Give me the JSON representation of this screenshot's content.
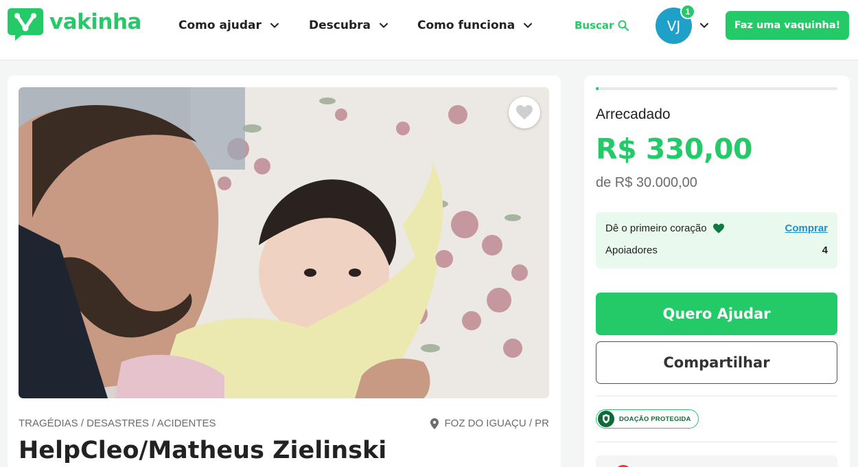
{
  "brand": {
    "name": "vakinha",
    "color": "#24ca68"
  },
  "nav": {
    "items": [
      {
        "label": "Como ajudar"
      },
      {
        "label": "Descubra"
      },
      {
        "label": "Como funciona"
      }
    ],
    "search_label": "Buscar",
    "user_initials": "VJ",
    "notification_count": "1",
    "cta_label": "Faz uma vaquinha!"
  },
  "campaign": {
    "image_alt": "Homem sorrindo ao lado de um bebê deitado",
    "category": "TRAGÉDIAS / DESASTRES / ACIDENTES",
    "location": "FOZ DO IGUAÇU / PR",
    "title": "HelpCleo/Matheus Zielinski"
  },
  "sidebar": {
    "progress_fraction": 0.011,
    "raised_label": "Arrecadado",
    "raised_value": "R$ 330,00",
    "goal_text": "de R$ 30.000,00",
    "first_heart_text": "Dê o primeiro coração",
    "buy_label": "Comprar",
    "supporters_label": "Apoiadores",
    "supporters_count": "4",
    "help_button": "Quero Ajudar",
    "share_button": "Compartilhar",
    "protected_label": "DOAÇÃO PROTEGIDA"
  },
  "icons": {
    "chevron": "chevron-down-icon",
    "search": "search-icon",
    "heart": "heart-icon",
    "pin": "location-pin-icon",
    "shield": "shield-icon"
  }
}
